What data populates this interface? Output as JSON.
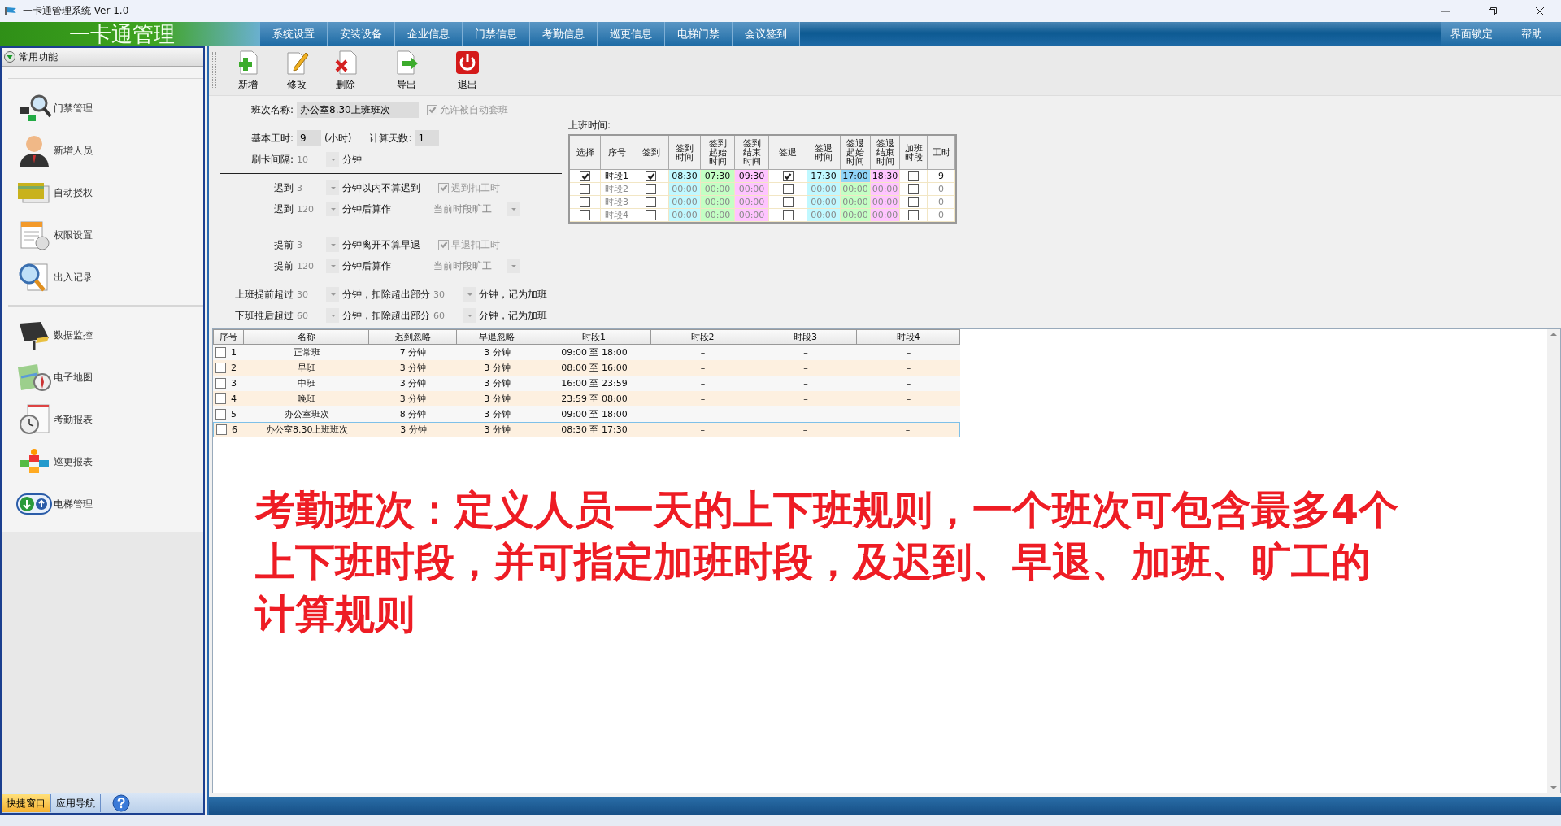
{
  "window": {
    "title": "一卡通管理系统  Ver 1.0"
  },
  "header": {
    "logo": "一卡通管理",
    "menu": [
      "系统设置",
      "安装设备",
      "企业信息",
      "门禁信息",
      "考勤信息",
      "巡更信息",
      "电梯门禁",
      "会议签到"
    ],
    "right_menu": [
      "界面锁定",
      "帮助"
    ]
  },
  "sidebar": {
    "title": "常用功能",
    "groups": [
      [
        {
          "label": "门禁管理",
          "kind": "access"
        },
        {
          "label": "新增人员",
          "kind": "person"
        },
        {
          "label": "自动授权",
          "kind": "card"
        },
        {
          "label": "权限设置",
          "kind": "permission"
        },
        {
          "label": "出入记录",
          "kind": "records"
        }
      ],
      [
        {
          "label": "数据监控",
          "kind": "monitor"
        },
        {
          "label": "电子地图",
          "kind": "map"
        },
        {
          "label": "考勤报表",
          "kind": "report"
        },
        {
          "label": "巡更报表",
          "kind": "patrol"
        },
        {
          "label": "电梯管理",
          "kind": "elevator"
        }
      ]
    ],
    "tabs": [
      {
        "label": "快捷窗口",
        "selected": true
      },
      {
        "label": "应用导航",
        "selected": false
      }
    ]
  },
  "toolbar": [
    [
      {
        "label": "新增",
        "kind": "add"
      },
      {
        "label": "修改",
        "kind": "edit"
      },
      {
        "label": "删除",
        "kind": "delete"
      }
    ],
    [
      {
        "label": "导出",
        "kind": "export"
      }
    ],
    [
      {
        "label": "退出",
        "kind": "exit"
      }
    ]
  ],
  "form": {
    "shift_name": {
      "label": "班次名称:",
      "value": "办公室8.30上班班次"
    },
    "auto_assign": {
      "label": "允许被自动套班",
      "checked": true
    },
    "base_hours": {
      "label": "基本工时:",
      "value": "9",
      "unit": "(小时)"
    },
    "calc_days": {
      "label": "计算天数:",
      "value": "1"
    },
    "swipe_interval": {
      "label": "刷卡间隔:",
      "value": "10",
      "unit": "分钟"
    },
    "late_rules": [
      {
        "kind": "checkbox",
        "label": "迟到",
        "value": "3",
        "text": "分钟以内不算迟到",
        "option": "迟到扣工时",
        "checked": true
      },
      {
        "kind": "select",
        "label": "迟到",
        "value": "120",
        "text": "分钟后算作",
        "option": "当前时段旷工"
      }
    ],
    "early_rules": [
      {
        "kind": "checkbox",
        "label": "提前",
        "value": "3",
        "text": "分钟离开不算早退",
        "option": "早退扣工时",
        "checked": true
      },
      {
        "kind": "select",
        "label": "提前",
        "value": "120",
        "text": "分钟后算作",
        "option": "当前时段旷工"
      }
    ],
    "overtime_rules": [
      {
        "label": "上班提前超过",
        "value": "30",
        "text": "分钟，扣除超出部分",
        "value2": "30",
        "text2": "分钟，记为加班"
      },
      {
        "label": "下班推后超过",
        "value": "60",
        "text": "分钟，扣除超出部分",
        "value2": "60",
        "text2": "分钟，记为加班"
      }
    ]
  },
  "schedule": {
    "title": "上班时间:",
    "columns": [
      "选择",
      "序号",
      "签到",
      "签到时间",
      "签到起始时间",
      "签到结束时间",
      "签退",
      "签退时间",
      "签退起始时间",
      "签退结束时间",
      "加班时段",
      "工时"
    ],
    "rows": [
      {
        "selected": true,
        "label": "时段1",
        "enabled": true,
        "check_in": true,
        "in_times": [
          {
            "value": "08:30",
            "focused": false
          },
          {
            "value": "07:30",
            "focused": false
          },
          {
            "value": "09:30",
            "focused": false
          }
        ],
        "check_out": true,
        "out_times": [
          {
            "value": "17:30",
            "focused": false
          },
          {
            "value": "17:00",
            "focused": true
          },
          {
            "value": "18:30",
            "focused": false
          }
        ],
        "overtime": false,
        "hours": "9"
      },
      {
        "selected": false,
        "label": "时段2",
        "enabled": false,
        "check_in": false,
        "in_times": [
          {
            "value": "00:00",
            "focused": false
          },
          {
            "value": "00:00",
            "focused": false
          },
          {
            "value": "00:00",
            "focused": false
          }
        ],
        "check_out": false,
        "out_times": [
          {
            "value": "00:00",
            "focused": false
          },
          {
            "value": "00:00",
            "focused": false
          },
          {
            "value": "00:00",
            "focused": false
          }
        ],
        "overtime": false,
        "hours": "0"
      },
      {
        "selected": false,
        "label": "时段3",
        "enabled": false,
        "check_in": false,
        "in_times": [
          {
            "value": "00:00",
            "focused": false
          },
          {
            "value": "00:00",
            "focused": false
          },
          {
            "value": "00:00",
            "focused": false
          }
        ],
        "check_out": false,
        "out_times": [
          {
            "value": "00:00",
            "focused": false
          },
          {
            "value": "00:00",
            "focused": false
          },
          {
            "value": "00:00",
            "focused": false
          }
        ],
        "overtime": false,
        "hours": "0"
      },
      {
        "selected": false,
        "label": "时段4",
        "enabled": false,
        "check_in": false,
        "in_times": [
          {
            "value": "00:00",
            "focused": false
          },
          {
            "value": "00:00",
            "focused": false
          },
          {
            "value": "00:00",
            "focused": false
          }
        ],
        "check_out": false,
        "out_times": [
          {
            "value": "00:00",
            "focused": false
          },
          {
            "value": "00:00",
            "focused": false
          },
          {
            "value": "00:00",
            "focused": false
          }
        ],
        "overtime": false,
        "hours": "0"
      }
    ]
  },
  "shift_table": {
    "columns": [
      "序号",
      "名称",
      "迟到忽略",
      "早退忽略",
      "时段1",
      "时段2",
      "时段3",
      "时段4"
    ],
    "rows": [
      {
        "checked": false,
        "selected": false,
        "cells": [
          "1",
          "正常班",
          "7 分钟",
          "3 分钟",
          "09:00 至 18:00",
          "–",
          "–",
          "–"
        ]
      },
      {
        "checked": false,
        "selected": false,
        "cells": [
          "2",
          "早班",
          "3 分钟",
          "3 分钟",
          "08:00 至 16:00",
          "–",
          "–",
          "–"
        ]
      },
      {
        "checked": false,
        "selected": false,
        "cells": [
          "3",
          "中班",
          "3 分钟",
          "3 分钟",
          "16:00 至 23:59",
          "–",
          "–",
          "–"
        ]
      },
      {
        "checked": false,
        "selected": false,
        "cells": [
          "4",
          "晚班",
          "3 分钟",
          "3 分钟",
          "23:59 至 08:00",
          "–",
          "–",
          "–"
        ]
      },
      {
        "checked": false,
        "selected": false,
        "cells": [
          "5",
          "办公室班次",
          "8 分钟",
          "3 分钟",
          "09:00 至 18:00",
          "–",
          "–",
          "–"
        ]
      },
      {
        "checked": false,
        "selected": true,
        "cells": [
          "6",
          "办公室8.30上班班次",
          "3 分钟",
          "3 分钟",
          "08:30 至 17:30",
          "–",
          "–",
          "–"
        ]
      }
    ]
  },
  "annotation": "考勤班次：定义人员一天的上下班规则，一个班次可包含最多4个上下班时段，并可指定加班时段，及迟到、早退、加班、旷工的计算规则"
}
